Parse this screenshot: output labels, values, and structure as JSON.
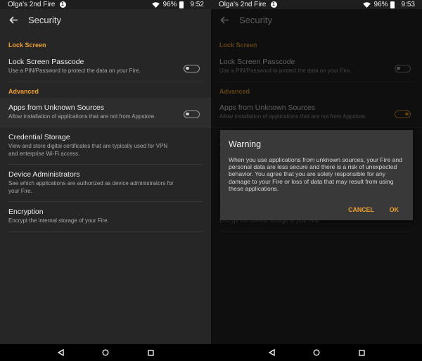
{
  "status": {
    "device": "Olga's 2nd Fire",
    "notification_count": "1",
    "battery": "96%",
    "time_left": "9:52",
    "time_right": "9:53"
  },
  "appbar": {
    "title": "Security"
  },
  "sections": {
    "lock": "Lock Screen",
    "advanced": "Advanced"
  },
  "items": {
    "passcode": {
      "title": "Lock Screen Passcode",
      "desc": "Use a PIN/Password to protect the data on your Fire.",
      "on": false
    },
    "unknown": {
      "title": "Apps from Unknown Sources",
      "desc": "Allow installation of applications that are not from Appstore.",
      "on_left": false,
      "on_right": true
    },
    "credential": {
      "title": "Credential Storage",
      "desc": "View and store digital certificates that are typically used for VPN and enterprise Wi-Fi access."
    },
    "admins": {
      "title": "Device Administrators",
      "desc": "See which applications are authorized as device administrators for your Fire."
    },
    "encryption": {
      "title": "Encryption",
      "desc": "Encrypt the internal storage of your Fire."
    }
  },
  "dialog": {
    "title": "Warning",
    "message": "When you use applications from unknown sources, your Fire and personal data are less secure and there is a risk of unexpected behavior. You agree that you are solely responsible for any damage to your Fire or loss of data that may result from using these applications.",
    "cancel": "CANCEL",
    "ok": "OK"
  },
  "colors": {
    "accent": "#f0a030",
    "background": "#262626",
    "dialog": "#393939"
  }
}
